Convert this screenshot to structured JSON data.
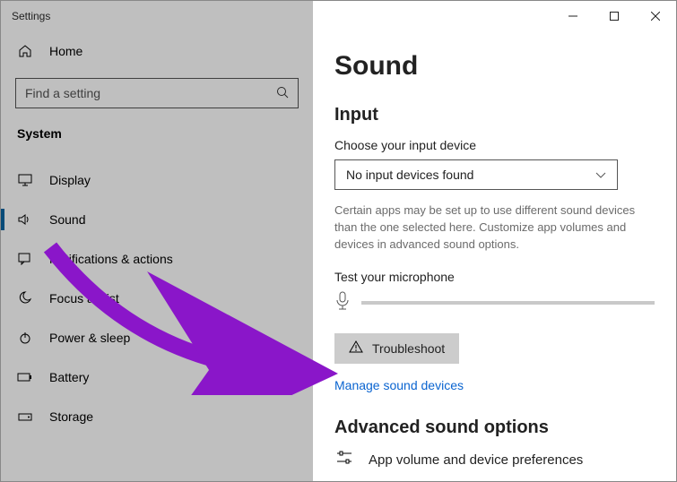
{
  "window": {
    "title": "Settings"
  },
  "sidebar": {
    "home": "Home",
    "search_placeholder": "Find a setting",
    "section": "System",
    "items": [
      {
        "label": "Display"
      },
      {
        "label": "Sound"
      },
      {
        "label": "Notifications & actions"
      },
      {
        "label": "Focus assist"
      },
      {
        "label": "Power & sleep"
      },
      {
        "label": "Battery"
      },
      {
        "label": "Storage"
      }
    ]
  },
  "main": {
    "title": "Sound",
    "input_heading": "Input",
    "choose_label": "Choose your input device",
    "input_selected": "No input devices found",
    "helper_text": "Certain apps may be set up to use different sound devices than the one selected here. Customize app volumes and devices in advanced sound options.",
    "test_label": "Test your microphone",
    "troubleshoot": "Troubleshoot",
    "manage_link": "Manage sound devices",
    "advanced_heading": "Advanced sound options",
    "advanced_item": "App volume and device preferences"
  }
}
